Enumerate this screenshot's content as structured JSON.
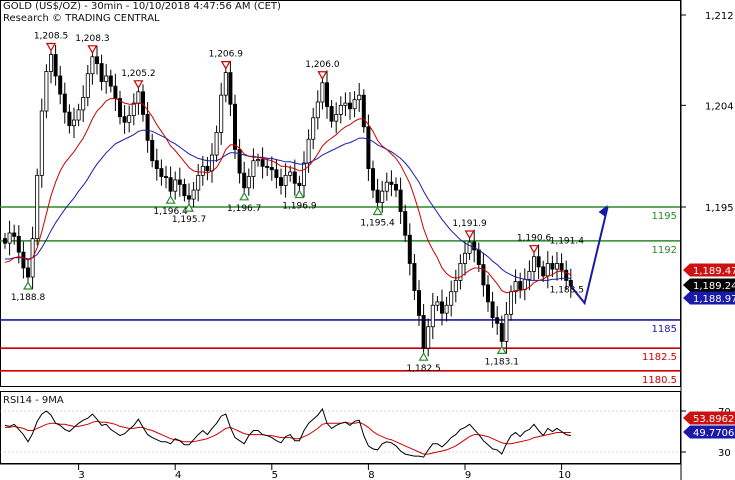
{
  "header": {
    "line1": "GOLD (US$/OZ) - 30min - 10/10/2018 4:47:56 AM (CET)",
    "line2": "Research © TRADING CENTRAL"
  },
  "colors": {
    "price": "#000000",
    "ma_fast": "#cc0000",
    "ma_slow": "#1a1aa8",
    "support_green": "#2a8a2a",
    "support_blue": "#1a1aa8",
    "support_red": "#cc0000",
    "forecast": "#1a1aa8",
    "badge_red": "#cc1111",
    "badge_black": "#000000",
    "badge_blue": "#1a1aa8"
  },
  "chart_data": [
    {
      "type": "line",
      "title": "GOLD (US$/OZ) - 30min",
      "x_tick_labels": [
        "3",
        "4",
        "5",
        "8",
        "9",
        "10"
      ],
      "y_ticks": [
        1195,
        1204,
        1212
      ],
      "y_tick_labels": [
        "1,195",
        "1,204",
        "1,212"
      ],
      "ylim": [
        1179,
        1214
      ],
      "grid": false,
      "series": [
        {
          "color": "#000000",
          "values": [
            1191.8,
            1192.7,
            1192.4,
            1191.0,
            1189.6,
            1188.8,
            1192.2,
            1197.8,
            1203.5,
            1207.0,
            1208.5,
            1206.6,
            1205.0,
            1203.4,
            1202.2,
            1202.7,
            1203.6,
            1204.7,
            1206.8,
            1208.3,
            1207.7,
            1206.1,
            1206.6,
            1205.7,
            1204.6,
            1203.0,
            1202.5,
            1203.1,
            1204.2,
            1205.2,
            1203.2,
            1200.9,
            1199.1,
            1198.4,
            1197.7,
            1197.6,
            1196.4,
            1197.4,
            1197.0,
            1196.0,
            1195.7,
            1196.5,
            1197.8,
            1198.6,
            1198.2,
            1199.6,
            1201.6,
            1204.9,
            1206.9,
            1204.1,
            1200.1,
            1198.0,
            1196.7,
            1197.7,
            1199.1,
            1199.2,
            1198.6,
            1198.5,
            1198.3,
            1197.6,
            1196.9,
            1197.8,
            1198.1,
            1197.1,
            1196.9,
            1198.9,
            1201.0,
            1202.9,
            1204.3,
            1206.0,
            1203.9,
            1202.6,
            1203.2,
            1204.0,
            1204.2,
            1203.7,
            1204.5,
            1204.9,
            1202.1,
            1198.4,
            1196.5,
            1195.4,
            1196.4,
            1197.2,
            1197.0,
            1196.5,
            1194.6,
            1192.5,
            1190.0,
            1187.6,
            1185.4,
            1182.5,
            1184.4,
            1186.3,
            1186.6,
            1185.6,
            1186.3,
            1187.5,
            1188.5,
            1190.0,
            1190.9,
            1191.9,
            1191.2,
            1189.9,
            1188.1,
            1186.6,
            1185.2,
            1184.7,
            1183.1,
            1185.5,
            1187.5,
            1188.4,
            1187.7,
            1188.6,
            1189.3,
            1190.6,
            1189.7,
            1188.9,
            1190.0,
            1189.5,
            1190.0,
            1189.4,
            1188.5,
            1188.0
          ],
          "values_note": "closes of the 124 half-hour bars, read left to right"
        },
        {
          "color": "#cc0000",
          "values": [
            1190.1,
            1190.2,
            1190.5,
            1190.6,
            1190.5,
            1190.3,
            1190.5,
            1191.4,
            1192.8,
            1194.4,
            1196.0,
            1197.2,
            1198.2,
            1198.9,
            1199.4,
            1199.9,
            1200.5,
            1201.1,
            1201.9,
            1202.8,
            1203.5,
            1203.9,
            1204.4,
            1204.6,
            1204.6,
            1204.4,
            1204.2,
            1204.1,
            1204.1,
            1204.2,
            1204.1,
            1203.6,
            1203.0,
            1202.3,
            1201.7,
            1201.1,
            1200.4,
            1200.0,
            1199.5,
            1199.0,
            1198.5,
            1198.2,
            1198.1,
            1198.1,
            1198.0,
            1198.2,
            1198.5,
            1199.2,
            1200.1,
            1200.5,
            1200.5,
            1200.2,
            1199.7,
            1199.5,
            1199.4,
            1199.4,
            1199.3,
            1199.2,
            1199.1,
            1198.9,
            1198.6,
            1198.6,
            1198.5,
            1198.4,
            1198.2,
            1198.3,
            1198.6,
            1199.1,
            1199.7,
            1200.4,
            1200.8,
            1201.1,
            1201.4,
            1201.8,
            1202.1,
            1202.3,
            1202.6,
            1202.8,
            1202.8,
            1202.3,
            1201.7,
            1200.9,
            1200.4,
            1200.1,
            1199.7,
            1199.3,
            1198.7,
            1197.9,
            1197.1,
            1195.9,
            1194.6,
            1193.1,
            1192.0,
            1191.2,
            1190.5,
            1189.6,
            1189.1,
            1188.8,
            1188.7,
            1188.8,
            1189.1,
            1189.4,
            1189.6,
            1189.6,
            1189.5,
            1189.2,
            1188.7,
            1188.2,
            1187.6,
            1187.4,
            1187.5,
            1187.6,
            1187.6,
            1187.7,
            1187.9,
            1188.3,
            1188.5,
            1188.6,
            1188.9,
            1189.0,
            1189.3,
            1189.3,
            1189.2,
            1189.0
          ],
          "values_note": "fast moving average"
        },
        {
          "color": "#1a1aa8",
          "values": [
            1190.4,
            1190.4,
            1190.5,
            1190.5,
            1190.5,
            1190.4,
            1190.5,
            1190.8,
            1191.4,
            1192.1,
            1192.9,
            1193.6,
            1194.2,
            1194.8,
            1195.3,
            1195.8,
            1196.4,
            1196.9,
            1197.5,
            1198.2,
            1198.8,
            1199.3,
            1199.8,
            1200.2,
            1200.6,
            1200.8,
            1201.0,
            1201.2,
            1201.4,
            1201.7,
            1201.8,
            1201.8,
            1201.7,
            1201.5,
            1201.3,
            1201.1,
            1200.8,
            1200.6,
            1200.3,
            1200.0,
            1199.7,
            1199.5,
            1199.3,
            1199.2,
            1199.1,
            1199.1,
            1199.1,
            1199.3,
            1199.6,
            1199.8,
            1199.8,
            1199.7,
            1199.6,
            1199.5,
            1199.5,
            1199.4,
            1199.4,
            1199.3,
            1199.3,
            1199.2,
            1199.1,
            1199.0,
            1199.0,
            1198.9,
            1198.8,
            1198.8,
            1198.9,
            1199.1,
            1199.3,
            1199.6,
            1199.8,
            1200.0,
            1200.2,
            1200.4,
            1200.6,
            1200.7,
            1200.9,
            1201.1,
            1201.1,
            1201.0,
            1200.8,
            1200.5,
            1200.3,
            1200.1,
            1199.9,
            1199.6,
            1199.3,
            1198.9,
            1198.4,
            1197.8,
            1197.2,
            1196.4,
            1195.7,
            1195.1,
            1194.5,
            1193.9,
            1193.4,
            1192.9,
            1192.5,
            1192.1,
            1191.8,
            1191.6,
            1191.4,
            1191.2,
            1190.9,
            1190.6,
            1190.2,
            1189.9,
            1189.5,
            1189.2,
            1189.0,
            1188.8,
            1188.7,
            1188.6,
            1188.5,
            1188.5,
            1188.5,
            1188.5,
            1188.5,
            1188.6,
            1188.6,
            1188.7,
            1188.7,
            1188.7
          ],
          "values_note": "slow moving average"
        }
      ],
      "levels": [
        {
          "value": 1195,
          "label": "1195",
          "color": "#2a8a2a"
        },
        {
          "value": 1192,
          "label": "1192",
          "color": "#2a8a2a"
        },
        {
          "value": 1185,
          "label": "1185",
          "color": "#1a1aa8"
        },
        {
          "value": 1182.5,
          "label": "1182.5",
          "color": "#cc0000"
        },
        {
          "value": 1180.5,
          "label": "1180.5",
          "color": "#cc0000"
        }
      ],
      "annotations": [
        {
          "type": "high",
          "label": "1,208.5",
          "bar": 10,
          "value": 1208.5
        },
        {
          "type": "high",
          "label": "1,208.3",
          "bar": 19,
          "value": 1208.3
        },
        {
          "type": "high",
          "label": "1,205.2",
          "bar": 29,
          "value": 1205.2
        },
        {
          "type": "high",
          "label": "1,206.9",
          "bar": 48,
          "value": 1206.9
        },
        {
          "type": "high",
          "label": "1,206.0",
          "bar": 69,
          "value": 1206.0
        },
        {
          "type": "high",
          "label": "1,191.9",
          "bar": 101,
          "value": 1191.9
        },
        {
          "type": "high",
          "label": "1,190.6",
          "bar": 115,
          "value": 1190.6
        },
        {
          "type": "low",
          "label": "1,188.8",
          "bar": 5,
          "value": 1188.8
        },
        {
          "type": "low",
          "label": "1,196.4",
          "bar": 36,
          "value": 1196.4
        },
        {
          "type": "low",
          "label": "1,195.7",
          "bar": 40,
          "value": 1195.7
        },
        {
          "type": "low",
          "label": "1,196.7",
          "bar": 52,
          "value": 1196.7
        },
        {
          "type": "low",
          "label": "1,196.9",
          "bar": 64,
          "value": 1196.9
        },
        {
          "type": "low",
          "label": "1,195.4",
          "bar": 81,
          "value": 1195.4
        },
        {
          "type": "low",
          "label": "1,182.5",
          "bar": 91,
          "value": 1182.5
        },
        {
          "type": "low",
          "label": "1,183.1",
          "bar": 108,
          "value": 1183.1
        },
        {
          "type": "text",
          "label": "1,191.4",
          "bar": 123,
          "value": 1191.4
        },
        {
          "type": "text",
          "label": "1,188.5",
          "bar": 123,
          "value": 1188.5
        }
      ],
      "forecast": {
        "color": "#1a1aa8",
        "points": [
          [
            123,
            1188.0
          ],
          [
            126,
            1186.5
          ],
          [
            131,
            1195.0
          ]
        ]
      },
      "price_badges": [
        {
          "label": "1,189.47",
          "value": 1189.47,
          "color": "#cc1111"
        },
        {
          "label": "1,189.24",
          "value": 1189.24,
          "color": "#000000"
        },
        {
          "label": "1,188.97",
          "value": 1188.97,
          "color": "#1a1aa8"
        }
      ]
    },
    {
      "type": "line",
      "title": "RSI14 - 9MA",
      "y_ticks": [
        30,
        70
      ],
      "y_tick_labels": [
        "30",
        "70"
      ],
      "ylim": [
        23,
        78
      ],
      "grid": false,
      "series": [
        {
          "color": "#000000",
          "values": [
            56,
            55,
            57,
            52,
            47,
            40,
            48,
            60,
            67,
            70,
            66,
            58,
            56,
            52,
            50,
            54,
            58,
            61,
            63,
            67,
            62,
            56,
            57,
            52,
            49,
            46,
            48,
            52,
            56,
            62,
            54,
            47,
            44,
            42,
            40,
            40,
            38,
            43,
            41,
            37,
            37,
            42,
            47,
            51,
            47,
            53,
            58,
            65,
            67,
            54,
            44,
            41,
            38,
            46,
            51,
            51,
            47,
            46,
            44,
            41,
            39,
            45,
            47,
            41,
            41,
            51,
            58,
            62,
            66,
            72,
            58,
            53,
            56,
            58,
            59,
            56,
            60,
            61,
            46,
            36,
            33,
            32,
            38,
            40,
            39,
            36,
            31,
            28,
            27,
            26,
            26,
            25,
            32,
            38,
            38,
            35,
            39,
            44,
            47,
            52,
            54,
            57,
            52,
            47,
            41,
            37,
            33,
            32,
            28,
            38,
            46,
            49,
            45,
            50,
            52,
            57,
            51,
            46,
            53,
            50,
            53,
            50,
            47,
            46
          ],
          "values_note": "RSI14"
        },
        {
          "color": "#cc0000",
          "values": [
            54,
            54,
            55,
            54,
            53,
            51,
            51,
            53,
            55,
            57,
            58,
            58,
            57,
            57,
            56,
            55,
            55,
            56,
            57,
            59,
            60,
            59,
            59,
            58,
            57,
            55,
            54,
            53,
            53,
            54,
            54,
            52,
            51,
            49,
            47,
            45,
            43,
            42,
            41,
            40,
            40,
            40,
            41,
            42,
            43,
            45,
            47,
            50,
            53,
            54,
            52,
            50,
            48,
            47,
            47,
            47,
            47,
            46,
            46,
            45,
            44,
            44,
            44,
            43,
            43,
            45,
            47,
            50,
            53,
            57,
            58,
            58,
            58,
            58,
            59,
            58,
            58,
            59,
            57,
            54,
            50,
            47,
            45,
            43,
            42,
            40,
            38,
            36,
            34,
            32,
            30,
            28,
            28,
            29,
            30,
            31,
            32,
            34,
            36,
            39,
            42,
            45,
            47,
            47,
            46,
            45,
            43,
            41,
            39,
            38,
            38,
            39,
            40,
            41,
            42,
            44,
            45,
            46,
            47,
            48,
            49,
            49,
            49,
            49
          ],
          "values_note": "9-period moving average of RSI14"
        }
      ],
      "level_lines": [
        70,
        30
      ],
      "value_badges": [
        {
          "label": "53.8962",
          "value": 53.8962,
          "color": "#cc1111"
        },
        {
          "label": "49.7706",
          "value": 49.7706,
          "color": "#1a1aa8"
        }
      ]
    }
  ]
}
